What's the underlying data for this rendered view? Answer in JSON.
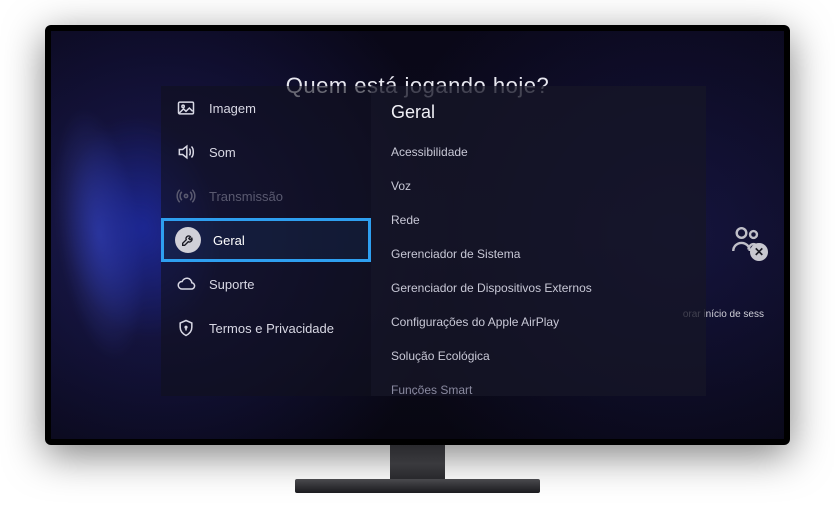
{
  "background": {
    "title": "Quem está jogando hoje?",
    "account_hint": "orar início de sess"
  },
  "menu": {
    "items": [
      {
        "label": "Imagem",
        "icon": "image-icon",
        "state": "normal"
      },
      {
        "label": "Som",
        "icon": "sound-icon",
        "state": "normal"
      },
      {
        "label": "Transmissão",
        "icon": "broadcast-icon",
        "state": "disabled"
      },
      {
        "label": "Geral",
        "icon": "wrench-icon",
        "state": "selected"
      },
      {
        "label": "Suporte",
        "icon": "cloud-icon",
        "state": "normal"
      },
      {
        "label": "Termos e Privacidade",
        "icon": "shield-icon",
        "state": "normal"
      }
    ],
    "selected_index": 3
  },
  "panel": {
    "title": "Geral",
    "items": [
      "Acessibilidade",
      "Voz",
      "Rede",
      "Gerenciador de Sistema",
      "Gerenciador de Dispositivos Externos",
      "Configurações do Apple AirPlay",
      "Solução Ecológica",
      "Funções Smart"
    ]
  }
}
